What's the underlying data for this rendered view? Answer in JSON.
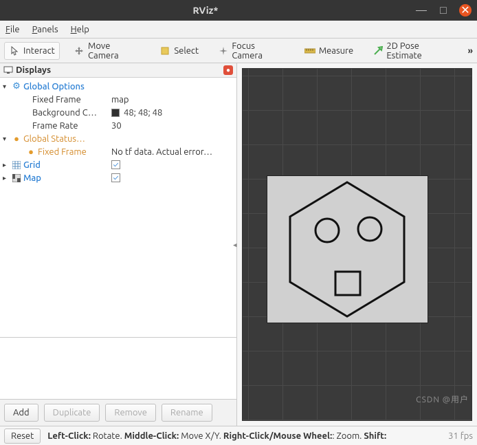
{
  "window": {
    "title": "RViz*"
  },
  "menubar": {
    "file": "File",
    "panels": "Panels",
    "help": "Help"
  },
  "toolbar": {
    "interact": "Interact",
    "move_camera": "Move Camera",
    "select": "Select",
    "focus_camera": "Focus Camera",
    "measure": "Measure",
    "pose_estimate": "2D Pose Estimate",
    "more": "»"
  },
  "displays_panel": {
    "title": "Displays",
    "tree": {
      "global_options": {
        "label": "Global Options",
        "fixed_frame": {
          "label": "Fixed Frame",
          "value": "map"
        },
        "background_color": {
          "label": "Background C…",
          "value": "48; 48; 48"
        },
        "frame_rate": {
          "label": "Frame Rate",
          "value": "30"
        }
      },
      "global_status": {
        "label": "Global Status…",
        "fixed_frame": {
          "label": "Fixed Frame",
          "value": "No tf data.  Actual error…"
        }
      },
      "grid": {
        "label": "Grid",
        "checked": true
      },
      "map": {
        "label": "Map",
        "checked": true
      }
    },
    "buttons": {
      "add": "Add",
      "duplicate": "Duplicate",
      "remove": "Remove",
      "rename": "Rename"
    }
  },
  "statusbar": {
    "reset": "Reset",
    "hint_lc_label": "Left-Click:",
    "hint_lc": " Rotate. ",
    "hint_mc_label": "Middle-Click:",
    "hint_mc": " Move X/Y. ",
    "hint_rc_label": "Right-Click/Mouse Wheel:",
    "hint_rc": ": Zoom. ",
    "hint_sh_label": "Shift:",
    "fps": "31 fps"
  },
  "watermark": "CSDN @用户"
}
